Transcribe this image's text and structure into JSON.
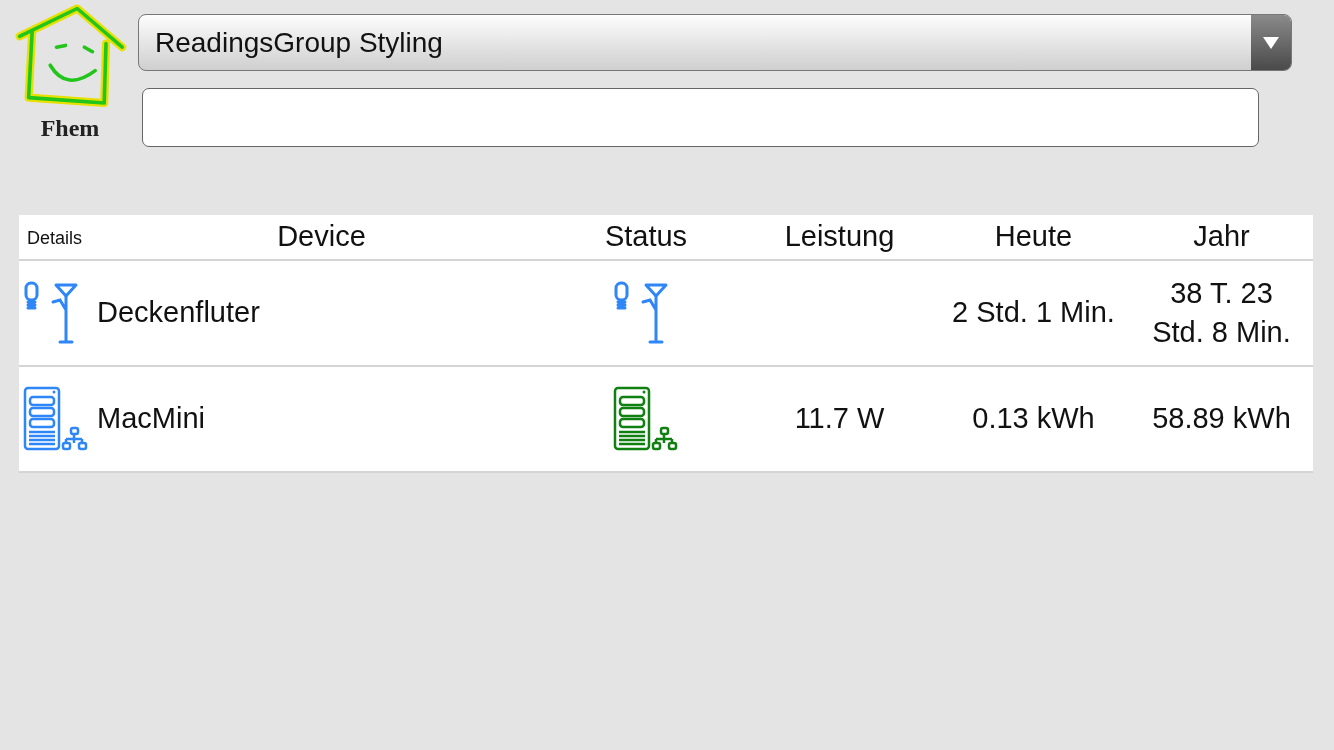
{
  "logo": {
    "text": "Fhem"
  },
  "room_select": {
    "value": "ReadingsGroup Styling"
  },
  "table": {
    "columns": [
      "Details",
      "Device",
      "Status",
      "Leistung",
      "Heute",
      "Jahr"
    ],
    "rows": [
      {
        "kind": "lamp",
        "device": "Deckenfluter",
        "color": "#2f86f6",
        "heute": "2 Std. 1 Min.",
        "jahr": "38 T. 23 Std. 8 Min."
      },
      {
        "kind": "server",
        "device": "MacMini",
        "color": "#108010",
        "leistung": "11.7 W",
        "heute": "0.13 kWh",
        "jahr": "58.89 kWh"
      }
    ]
  }
}
